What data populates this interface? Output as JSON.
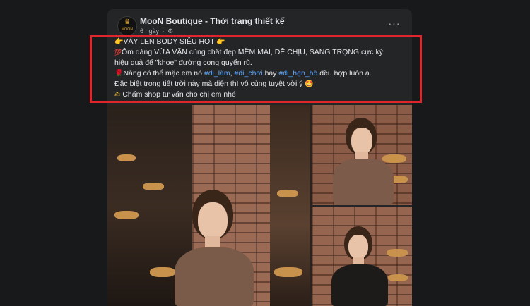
{
  "post": {
    "page_name": "MooN Boutique - Thời trang thiết kế",
    "avatar_text": "MOON",
    "time": "6 ngày",
    "dot": "·",
    "more_label": "···"
  },
  "caption": {
    "line1": "VÁY LEN BODY SIÊU HOT",
    "line2": "Ôm dáng VỪA VẶN cùng chất đẹp MỀM MẠI, DỄ CHỊU, SANG TRỌNG cực kỳ",
    "line3": "hiệu quả để \"khoe\" đường cong quyến rũ.",
    "line4_a": "Nàng có thể mặc em nó ",
    "tag1": "#đi_làm",
    "sep1": ", ",
    "tag2": "#đi_chơi",
    "line4_b": " hay ",
    "tag3": "#đi_hẹn_hò",
    "line4_c": " đều hợp luôn ạ.",
    "line5": "Đặc biệt trong tiết trời này mà diện thì vô cùng tuyệt vời ý ",
    "line6": "Chấm shop tư vấn cho chị em nhé"
  },
  "icons": {
    "hand": "👉",
    "hundred": "💯",
    "rose": "🌹",
    "star_eyes": "🤩",
    "writing_hand": "✍",
    "gear": "⚙",
    "crown": "♛"
  },
  "colors": {
    "highlight_border": "#e0262a",
    "hashtag": "#5aa7ff",
    "card_bg": "#242526",
    "page_bg": "#18191a"
  }
}
